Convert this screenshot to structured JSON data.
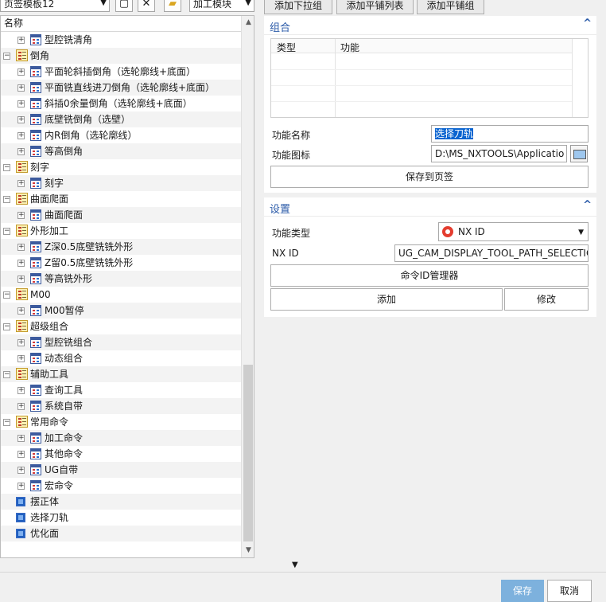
{
  "toolbar": {
    "template_select": "页签模板12",
    "module_select": "加工模块"
  },
  "tree": {
    "column_header": "名称",
    "rows": [
      {
        "level": 1,
        "type": "cmd",
        "label": "型腔铣清角"
      },
      {
        "level": 0,
        "type": "group",
        "label": "倒角"
      },
      {
        "level": 1,
        "type": "cmd",
        "label": "平面轮斜插倒角（选轮廓线+底面）"
      },
      {
        "level": 1,
        "type": "cmd",
        "label": "平面铣直线进刀倒角（选轮廓线+底面）"
      },
      {
        "level": 1,
        "type": "cmd",
        "label": "斜插0余量倒角（选轮廓线+底面）"
      },
      {
        "level": 1,
        "type": "cmd",
        "label": "底壁铣倒角（选壁）"
      },
      {
        "level": 1,
        "type": "cmd",
        "label": "内R倒角（选轮廓线）"
      },
      {
        "level": 1,
        "type": "cmd",
        "label": "等高倒角"
      },
      {
        "level": 0,
        "type": "group",
        "label": "刻字"
      },
      {
        "level": 1,
        "type": "cmd",
        "label": "刻字"
      },
      {
        "level": 0,
        "type": "group",
        "label": "曲面爬面"
      },
      {
        "level": 1,
        "type": "cmd",
        "label": "曲面爬面"
      },
      {
        "level": 0,
        "type": "group",
        "label": "外形加工"
      },
      {
        "level": 1,
        "type": "cmd",
        "label": "Z深0.5底壁铣铣外形"
      },
      {
        "level": 1,
        "type": "cmd",
        "label": "Z留0.5底壁铣铣外形"
      },
      {
        "level": 1,
        "type": "cmd",
        "label": "等高铣外形"
      },
      {
        "level": 0,
        "type": "group",
        "label": "M00"
      },
      {
        "level": 1,
        "type": "cmd",
        "label": "M00暂停"
      },
      {
        "level": 0,
        "type": "group",
        "label": "超级组合"
      },
      {
        "level": 1,
        "type": "cmd",
        "label": "型腔铣组合"
      },
      {
        "level": 1,
        "type": "cmd",
        "label": "动态组合"
      },
      {
        "level": 0,
        "type": "group",
        "label": "辅助工具"
      },
      {
        "level": 1,
        "type": "cmd",
        "label": "查询工具"
      },
      {
        "level": 1,
        "type": "cmd",
        "label": "系统自带"
      },
      {
        "level": 0,
        "type": "group",
        "label": "常用命令"
      },
      {
        "level": 1,
        "type": "cmd",
        "label": "加工命令"
      },
      {
        "level": 1,
        "type": "cmd",
        "label": "其他命令"
      },
      {
        "level": 1,
        "type": "cmd",
        "label": "UG自带"
      },
      {
        "level": 1,
        "type": "cmd",
        "label": "宏命令"
      },
      {
        "level": 0,
        "type": "single",
        "label": "摆正体"
      },
      {
        "level": 0,
        "type": "single",
        "label": "选择刀轨"
      },
      {
        "level": 0,
        "type": "single",
        "label": "优化面"
      }
    ]
  },
  "right": {
    "tabs": [
      "添加下拉组",
      "添加平铺列表",
      "添加平铺组"
    ],
    "combo_section": {
      "title": "组合",
      "grid_columns": [
        "类型",
        "功能"
      ],
      "func_name_label": "功能名称",
      "func_name_value": "选择刀轨",
      "func_icon_label": "功能图标",
      "func_icon_value": "D:\\MS_NXTOOLS\\Applicatio",
      "save_button": "保存到页签"
    },
    "settings_section": {
      "title": "设置",
      "func_type_label": "功能类型",
      "func_type_value": "NX ID",
      "nxid_label": "NX ID",
      "nxid_value": "UG_CAM_DISPLAY_TOOL_PATH_SELECTIC",
      "manager_button": "命令ID管理器",
      "add_button": "添加",
      "modify_button": "修改"
    }
  },
  "footer": {
    "save_button": "保存",
    "cancel_button": "取消"
  },
  "colors": {
    "accent": "#2a5aa8",
    "selection": "#0a64d0",
    "save_button_bg": "#7db1dd"
  }
}
